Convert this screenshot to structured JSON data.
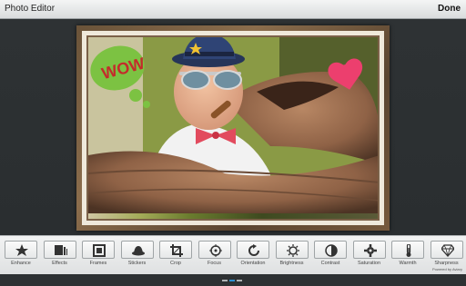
{
  "titlebar": {
    "title": "Photo Editor",
    "done_label": "Done"
  },
  "stickers": {
    "speech_text": "WOW"
  },
  "toolbar": {
    "tools": [
      {
        "label": "Enhance",
        "icon": "enhance-star-icon"
      },
      {
        "label": "Effects",
        "icon": "effects-layers-icon"
      },
      {
        "label": "Frames",
        "icon": "frames-icon"
      },
      {
        "label": "Stickers",
        "icon": "stickers-hat-icon"
      },
      {
        "label": "Crop",
        "icon": "crop-icon"
      },
      {
        "label": "Focus",
        "icon": "focus-target-icon"
      },
      {
        "label": "Orientation",
        "icon": "orientation-rotate-icon"
      },
      {
        "label": "Brightness",
        "icon": "brightness-sun-icon"
      },
      {
        "label": "Contrast",
        "icon": "contrast-icon"
      },
      {
        "label": "Saturation",
        "icon": "saturation-gear-icon"
      },
      {
        "label": "Warmth",
        "icon": "warmth-thermometer-icon"
      },
      {
        "label": "Sharpness",
        "icon": "sharpness-diamond-icon"
      }
    ],
    "pager": {
      "pages": 3,
      "active": 1
    },
    "powered_by": "Powered by Aviary"
  },
  "colors": {
    "frame_wood": "#6a5339",
    "heart": "#ec3f6e",
    "speech_bubble": "#7cc242",
    "hat": "#2a3a66"
  }
}
